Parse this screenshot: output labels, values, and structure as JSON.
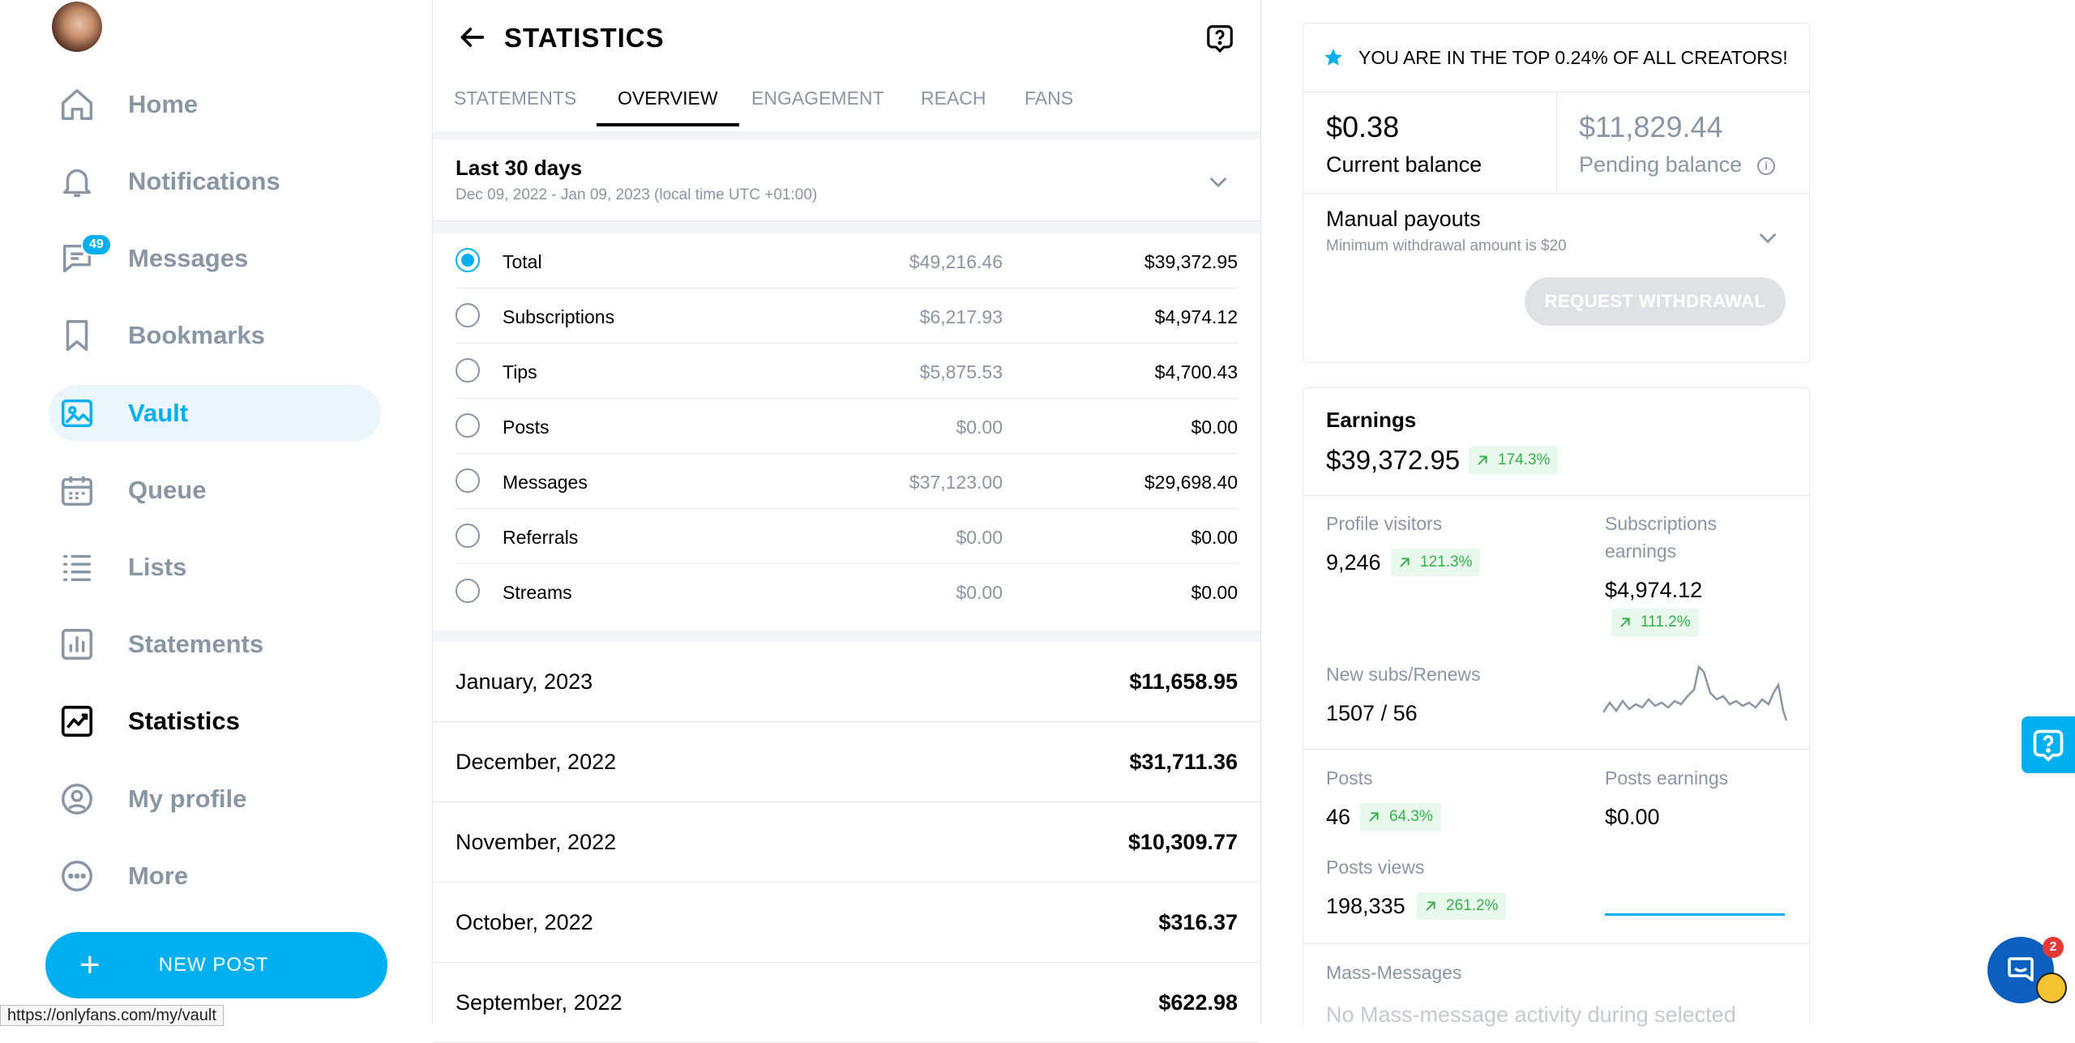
{
  "sidebar": {
    "items": [
      {
        "label": "Home",
        "icon": "home-icon"
      },
      {
        "label": "Notifications",
        "icon": "bell-icon"
      },
      {
        "label": "Messages",
        "icon": "message-icon",
        "badge": "49"
      },
      {
        "label": "Bookmarks",
        "icon": "bookmark-icon"
      },
      {
        "label": "Vault",
        "icon": "image-icon"
      },
      {
        "label": "Queue",
        "icon": "calendar-icon"
      },
      {
        "label": "Lists",
        "icon": "list-icon"
      },
      {
        "label": "Statements",
        "icon": "bar-chart-icon"
      },
      {
        "label": "Statistics",
        "icon": "line-chart-icon"
      },
      {
        "label": "My profile",
        "icon": "profile-icon"
      },
      {
        "label": "More",
        "icon": "more-icon"
      }
    ],
    "active_item": "Vault",
    "current_item": "Statistics",
    "new_post_label": "NEW POST",
    "status_url": "https://onlyfans.com/my/vault"
  },
  "stats": {
    "title": "STATISTICS",
    "tabs": [
      "STATEMENTS",
      "OVERVIEW",
      "ENGAGEMENT",
      "REACH",
      "FANS"
    ],
    "active_tab": "OVERVIEW",
    "range_title": "Last 30 days",
    "range_sub": "Dec 09, 2022 - Jan 09, 2023 (local time UTC +01:00)",
    "earnings": [
      {
        "name": "Total",
        "gross": "$49,216.46",
        "net": "$39,372.95",
        "selected": true
      },
      {
        "name": "Subscriptions",
        "gross": "$6,217.93",
        "net": "$4,974.12"
      },
      {
        "name": "Tips",
        "gross": "$5,875.53",
        "net": "$4,700.43"
      },
      {
        "name": "Posts",
        "gross": "$0.00",
        "net": "$0.00"
      },
      {
        "name": "Messages",
        "gross": "$37,123.00",
        "net": "$29,698.40"
      },
      {
        "name": "Referrals",
        "gross": "$0.00",
        "net": "$0.00"
      },
      {
        "name": "Streams",
        "gross": "$0.00",
        "net": "$0.00"
      }
    ],
    "months": [
      {
        "name": "January, 2023",
        "value": "$11,658.95"
      },
      {
        "name": "December, 2022",
        "value": "$31,711.36"
      },
      {
        "name": "November, 2022",
        "value": "$10,309.77"
      },
      {
        "name": "October, 2022",
        "value": "$316.37"
      },
      {
        "name": "September, 2022",
        "value": "$622.98"
      }
    ]
  },
  "right": {
    "banner": "YOU ARE IN THE TOP 0.24% OF ALL CREATORS!",
    "current_balance": "$0.38",
    "current_balance_label": "Current balance",
    "pending_balance": "$11,829.44",
    "pending_balance_label": "Pending balance",
    "payouts_title": "Manual payouts",
    "payouts_sub": "Minimum withdrawal amount is $20",
    "withdraw_label": "REQUEST WITHDRAWAL",
    "earnings_title": "Earnings",
    "earnings_value": "$39,372.95",
    "earnings_change": "174.3%",
    "profile_visitors_label": "Profile visitors",
    "profile_visitors": "9,246",
    "profile_visitors_change": "121.3%",
    "sub_earnings_label_1": "Subscriptions",
    "sub_earnings_label_2": "earnings",
    "sub_earnings": "$4,974.12",
    "sub_earnings_change": "111.2%",
    "new_subs_label": "New subs/Renews",
    "new_subs": "1507 / 56",
    "posts_label": "Posts",
    "posts": "46",
    "posts_change": "64.3%",
    "posts_earnings_label": "Posts earnings",
    "posts_earnings": "$0.00",
    "posts_views_label": "Posts views",
    "posts_views": "198,335",
    "posts_views_change": "261.2%",
    "mass_label": "Mass-Messages",
    "mass_text": "No Mass-message activity during selected"
  },
  "floating": {
    "chat_badge": "2"
  },
  "colors": {
    "accent": "#00aff0",
    "positive": "#35b24a",
    "muted": "#8a96a3"
  }
}
